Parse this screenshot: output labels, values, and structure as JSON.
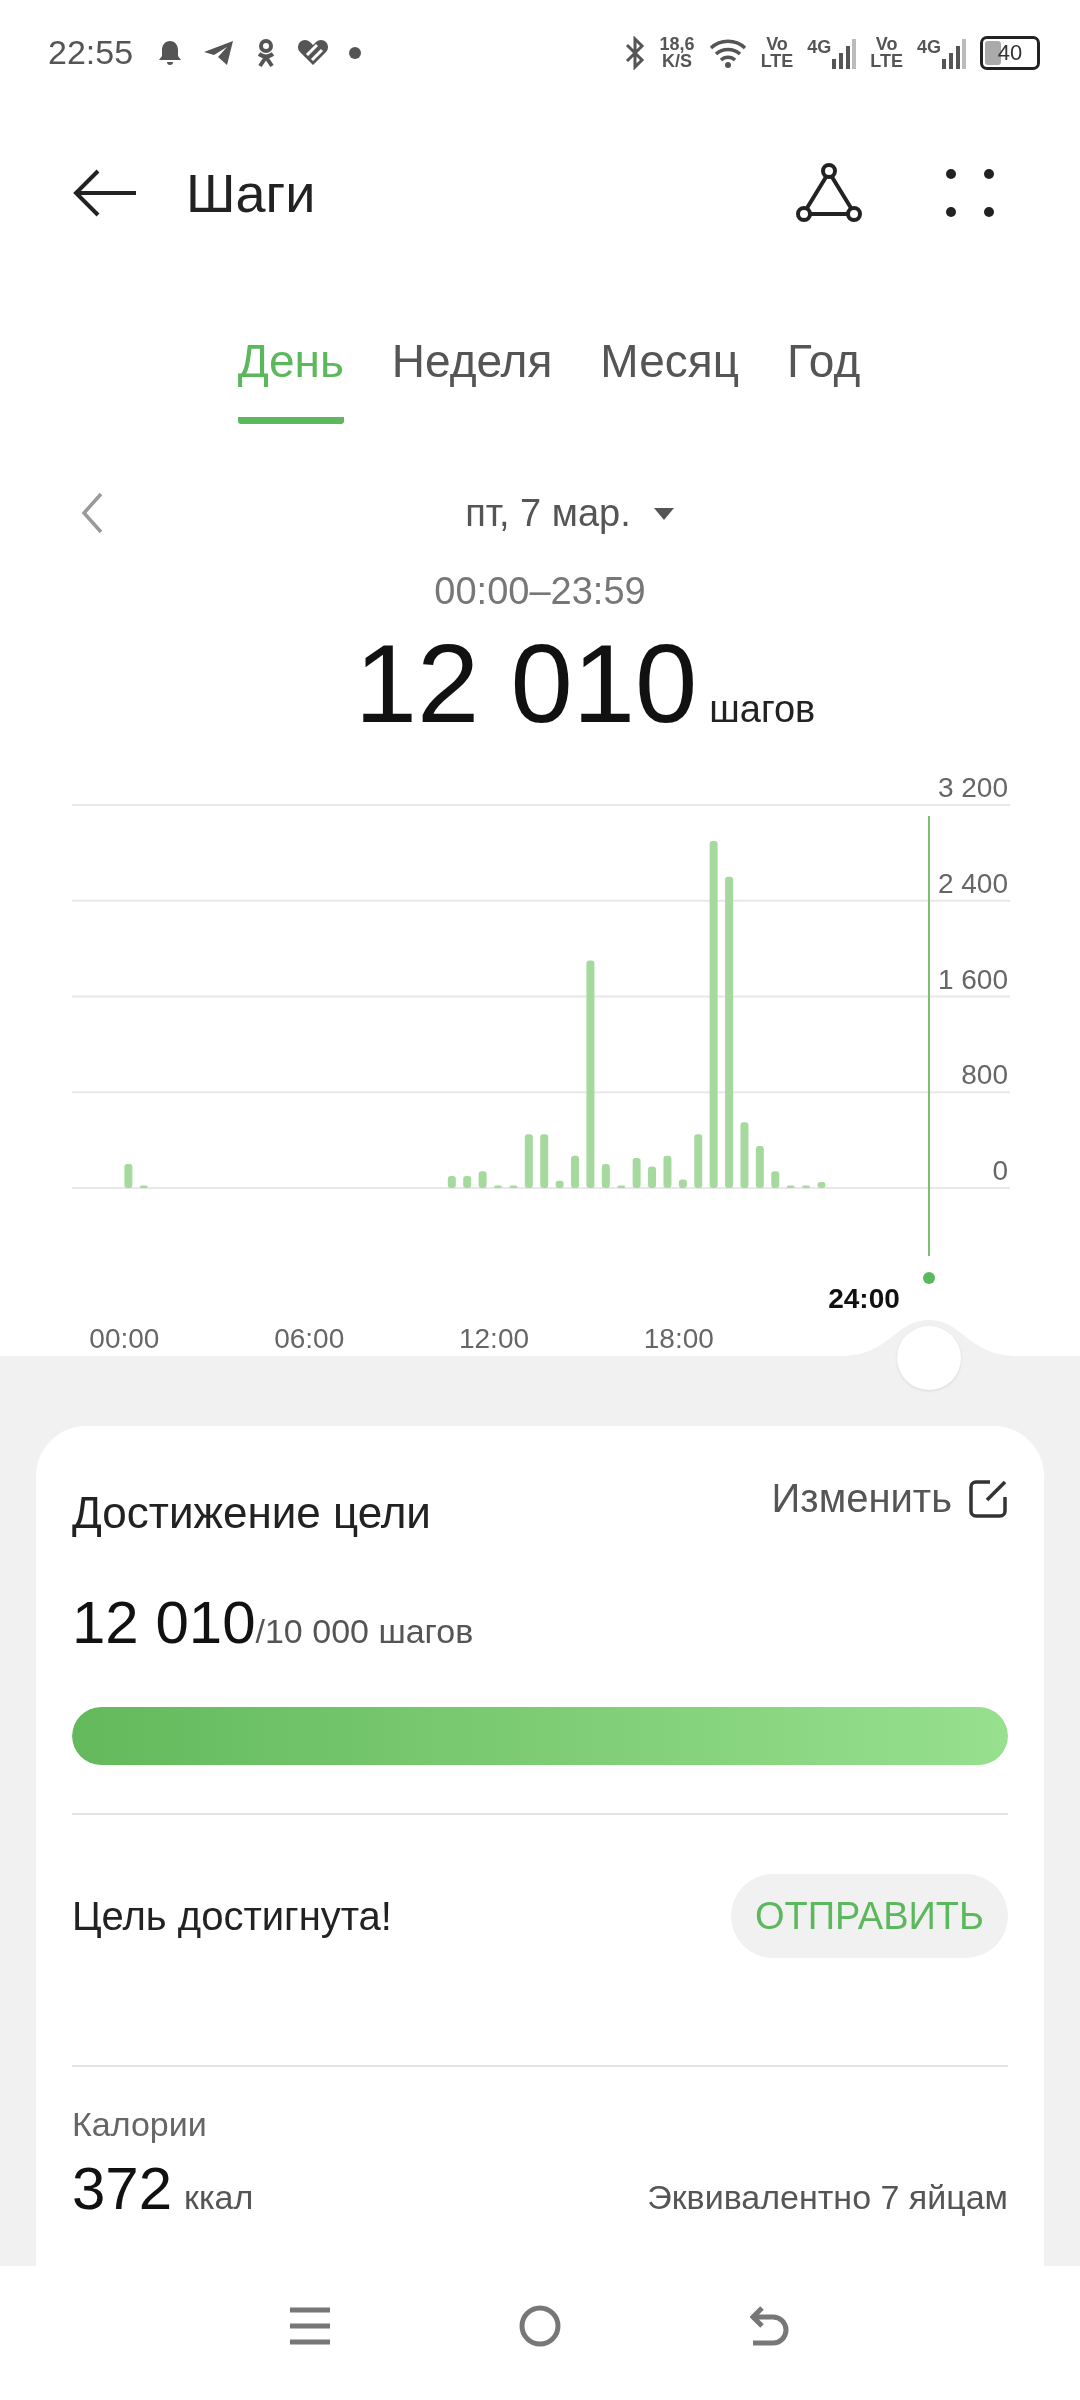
{
  "status_bar": {
    "time": "22:55",
    "net_speed": "18,6",
    "net_speed_unit": "K/S",
    "sims": [
      {
        "volte_top": "Vo",
        "volte_bottom": "LTE",
        "network": "4G"
      },
      {
        "volte_top": "Vo",
        "volte_bottom": "LTE",
        "network": "4G"
      }
    ],
    "battery": "40"
  },
  "header": {
    "title": "Шаги"
  },
  "tabs": [
    {
      "label": "День",
      "selected": true
    },
    {
      "label": "Неделя",
      "selected": false
    },
    {
      "label": "Месяц",
      "selected": false
    },
    {
      "label": "Год",
      "selected": false
    }
  ],
  "date": {
    "label": "пт, 7 мар."
  },
  "summary": {
    "time_range": "00:00–23:59",
    "steps": "12 010",
    "unit": "шагов"
  },
  "chart": {
    "cursor_label": "24:00",
    "chart_data": {
      "type": "bar",
      "grid": true,
      "x": [
        0,
        0.5,
        1,
        1.5,
        2,
        2.5,
        3,
        3.5,
        4,
        4.5,
        5,
        5.5,
        6,
        6.5,
        7,
        7.5,
        8,
        8.5,
        9,
        9.5,
        10,
        10.5,
        11,
        11.5,
        12,
        12.5,
        13,
        13.5,
        14,
        14.5,
        15,
        15.5,
        16,
        16.5,
        17,
        17.5,
        18,
        18.5,
        19,
        19.5,
        20,
        20.5,
        21,
        21.5,
        22,
        22.5,
        23,
        23.5
      ],
      "series": [
        {
          "color": "#a5d99e",
          "values": [
            200,
            20,
            0,
            0,
            0,
            0,
            0,
            0,
            0,
            0,
            0,
            0,
            0,
            0,
            0,
            0,
            0,
            0,
            0,
            0,
            0,
            100,
            100,
            140,
            20,
            20,
            450,
            450,
            60,
            270,
            1900,
            200,
            20,
            250,
            180,
            270,
            70,
            450,
            2900,
            2600,
            550,
            350,
            140,
            20,
            20,
            50,
            0,
            0
          ]
        }
      ],
      "xlim": [
        -1.7,
        28.75
      ],
      "ylim": [
        0,
        3200
      ],
      "yticks": [
        {
          "value": 0,
          "label": "0"
        },
        {
          "value": 800,
          "label": "800"
        },
        {
          "value": 1600,
          "label": "1 600"
        },
        {
          "value": 2400,
          "label": "2 400"
        },
        {
          "value": 3200,
          "label": "3 200"
        }
      ],
      "xticks": [
        {
          "value": 0,
          "label": "00:00"
        },
        {
          "value": 6,
          "label": "06:00"
        },
        {
          "value": 12,
          "label": "12:00"
        },
        {
          "value": 18,
          "label": "18:00"
        }
      ]
    }
  },
  "goal_card": {
    "title": "Достижение цели",
    "edit_label": "Изменить",
    "steps": "12 010",
    "goal": "/10 000 шагов",
    "level": 1,
    "status": "Цель достигнута!",
    "share_button": "ОТПРАВИТЬ"
  },
  "calories": {
    "label": "Калории",
    "value": "372",
    "unit": "ккал",
    "equivalent": "Эквивалентно 7 яйцам"
  }
}
